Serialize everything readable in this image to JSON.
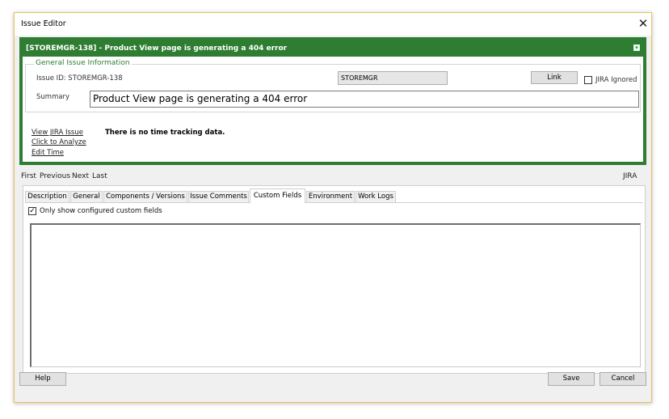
{
  "window": {
    "title": "Issue Editor",
    "close_glyph": "✕"
  },
  "issue": {
    "header": "[STOREMGR-138] - Product View page is generating a 404 error",
    "collapse_glyph": "▾",
    "group_title": "General Issue Information",
    "issue_id_label": "Issue ID: STOREMGR-138",
    "project": "STOREMGR",
    "link_label": "Link",
    "jira_ignored_label": "JIRA Ignored",
    "jira_ignored_checked": false,
    "summary_label": "Summary",
    "summary_value": "Product View page is generating a 404 error",
    "links": [
      "View JIRA Issue",
      "Click to Analyze",
      "Edit Time"
    ],
    "time_tracking": "There is no time tracking data."
  },
  "nav": {
    "first": "First",
    "previous": "Previous",
    "next": "Next",
    "last": "Last",
    "source": "JIRA"
  },
  "tabs": [
    {
      "label": "Description"
    },
    {
      "label": "General"
    },
    {
      "label": "Components / Versions"
    },
    {
      "label": "Issue Comments"
    },
    {
      "label": "Custom Fields",
      "active": true
    },
    {
      "label": "Environment"
    },
    {
      "label": "Work Logs"
    }
  ],
  "custom_fields": {
    "only_configured_label": "Only show configured custom fields",
    "only_configured_checked": true
  },
  "footer": {
    "help": "Help",
    "save": "Save",
    "cancel": "Cancel"
  },
  "colors": {
    "header_green": "#2e7d32",
    "window_border": "#e8c35a"
  }
}
